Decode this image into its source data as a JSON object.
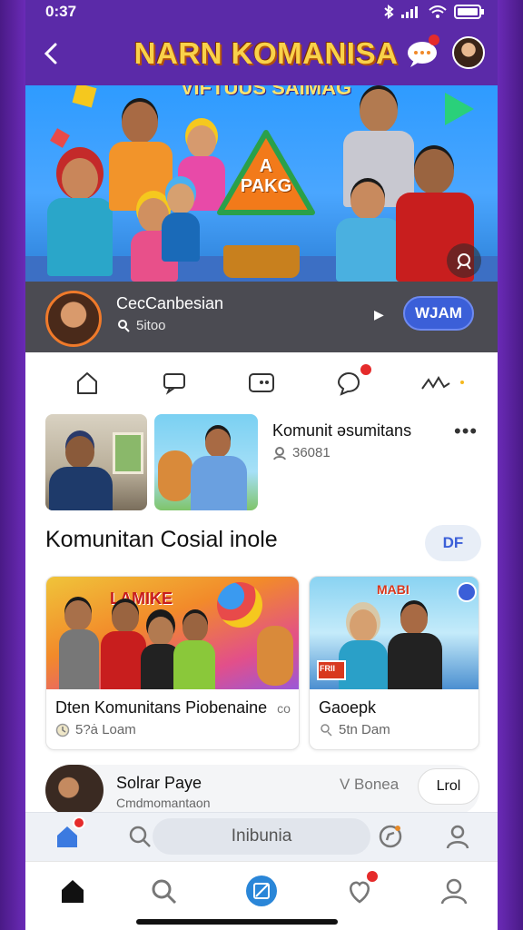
{
  "status_bar": {
    "time": "0:37"
  },
  "header": {
    "title": "NARN KOMANISA",
    "subtitle": "VIFTUUS SAIMAG",
    "chat_badge": true
  },
  "banner": {
    "sign_text": "A\nPAKG"
  },
  "profile": {
    "name": "CecCanbesian",
    "sub": "5itoo",
    "join_label": "WJAM"
  },
  "tabs": [
    {
      "icon": "home-outline-icon"
    },
    {
      "icon": "message-icon"
    },
    {
      "icon": "video-chat-icon"
    },
    {
      "icon": "chat-bubble-icon",
      "badge": true
    },
    {
      "icon": "activity-icon"
    }
  ],
  "community": {
    "title": "Komunit əsumitans",
    "sub": "36081",
    "more": "•••"
  },
  "section": {
    "title": "Komunitan Cosial inole",
    "button_label": "DF"
  },
  "cards": [
    {
      "title": "Dten Komunitans Piobenaine",
      "title_suffix": "co",
      "sub": "5?ȧ Loam",
      "image_text": "LAMIKE"
    },
    {
      "title": "Gaoepk",
      "sub": "5tn Dam",
      "image_text": "MABI",
      "image_text2": "FRII"
    }
  ],
  "list_item": {
    "title": "Solrar Paye",
    "sub": "Cmdmomantaon",
    "mid_label": "V Bonea",
    "button_label": "Lrol"
  },
  "search": {
    "placeholder": "Inibunia"
  },
  "bottom_nav": [
    {
      "icon": "home-icon",
      "active": true
    },
    {
      "icon": "search-icon"
    },
    {
      "icon": "compose-icon"
    },
    {
      "icon": "heart-notification-icon",
      "badge": true
    },
    {
      "icon": "profile-icon"
    }
  ],
  "colors": {
    "brand_purple": "#5b2aa8",
    "accent_blue": "#3b5fd8",
    "badge_red": "#e52b2b",
    "title_yellow": "#f9d24a"
  }
}
